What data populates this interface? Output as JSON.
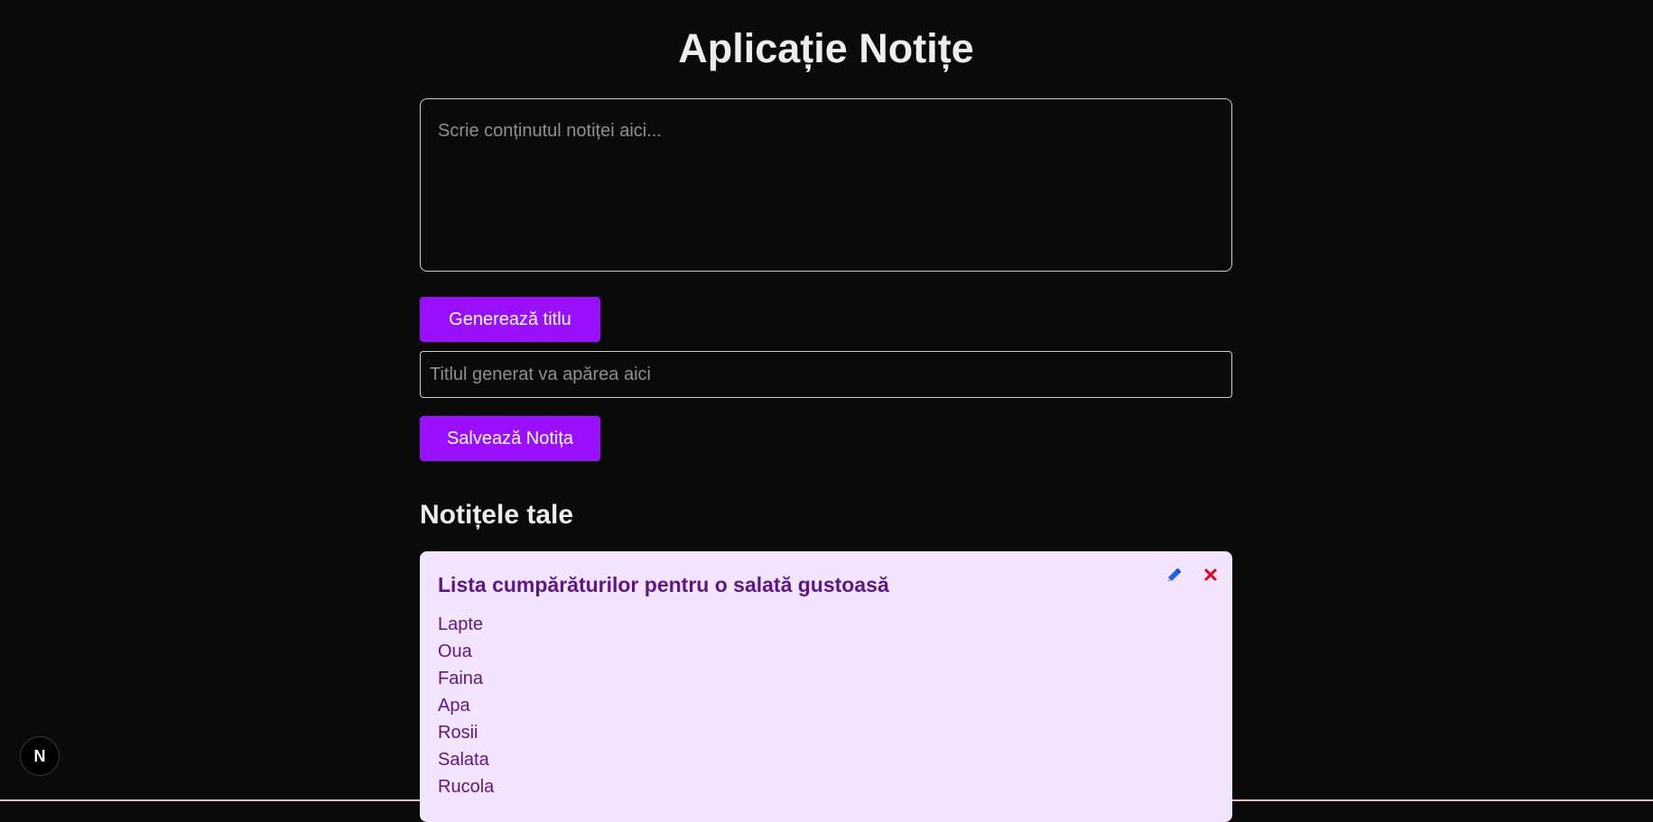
{
  "app": {
    "title": "Aplicație Notițe"
  },
  "editor": {
    "content_placeholder": "Scrie conținutul notiței aici...",
    "content_value": "",
    "generate_button_label": "Generează titlu",
    "title_placeholder": "Titlul generat va apărea aici",
    "title_value": "",
    "save_button_label": "Salvează Notița"
  },
  "notes_section": {
    "heading": "Notițele tale",
    "notes": [
      {
        "title": "Lista cumpărăturilor pentru o salată gustoasă",
        "lines": [
          "Lapte",
          "Oua",
          "Faina",
          "Apa",
          "Rosii",
          "Salata",
          "Rucola"
        ],
        "actions": {
          "edit_icon": "pencil-icon",
          "delete_icon": "close-icon"
        }
      }
    ]
  },
  "dev_badge": {
    "icon": "nextjs-logo-icon",
    "glyph": "N"
  },
  "colors": {
    "background": "#0a0a0a",
    "primary_button": "#9b0fff",
    "card_background": "#f3e5fd",
    "card_text": "#5e1687",
    "edit_icon": "#1d63e8",
    "delete_icon": "#e00024"
  }
}
